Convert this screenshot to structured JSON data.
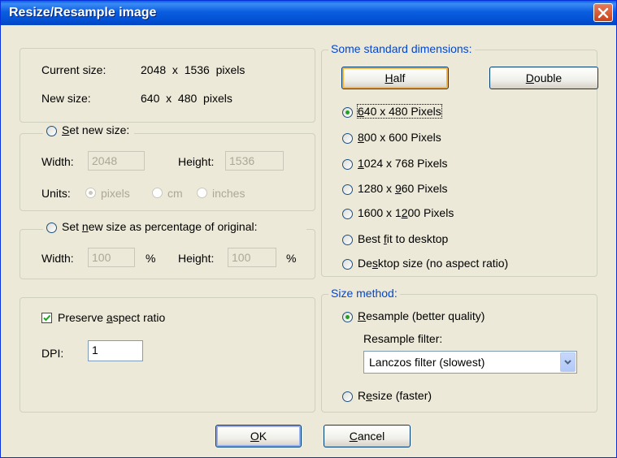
{
  "window": {
    "title": "Resize/Resample image"
  },
  "info": {
    "current_label": "Current size:",
    "current_value": "2048  x  1536  pixels",
    "new_label": "New size:",
    "new_value": "640  x  480  pixels"
  },
  "set_new_size": {
    "label_pre": "",
    "label_u": "S",
    "label_post": "et new size:",
    "width_label": "Width:",
    "width_value": "2048",
    "height_label": "Height:",
    "height_value": "1536",
    "units_label": "Units:",
    "units": [
      "pixels",
      "cm",
      "inches"
    ],
    "units_selected": "pixels"
  },
  "percentage": {
    "label_pre": "Set ",
    "label_u": "n",
    "label_post": "ew size as percentage of original:",
    "width_label": "Width:",
    "width_value": "100",
    "height_label": "Height:",
    "height_value": "100",
    "pct": "%"
  },
  "aspect": {
    "label_pre": "Preserve ",
    "label_u": "a",
    "label_post": "spect ratio",
    "checked": true,
    "dpi_label": "DPI:",
    "dpi_value": "1"
  },
  "standard": {
    "legend": "Some standard dimensions:",
    "half_u": "H",
    "half_post": "alf",
    "double_u": "D",
    "double_post": "ouble",
    "options": [
      {
        "pre": "",
        "u": "6",
        "post": "40 x 480 Pixels",
        "selected": true
      },
      {
        "pre": "",
        "u": "8",
        "post": "00 x 600 Pixels",
        "selected": false
      },
      {
        "pre": "",
        "u": "1",
        "post": "024 x 768 Pixels",
        "selected": false
      },
      {
        "pre": "1280 x ",
        "u": "9",
        "post": "60 Pixels",
        "selected": false
      },
      {
        "pre": "1600 x 1",
        "u": "2",
        "post": "00 Pixels",
        "selected": false
      },
      {
        "pre": "Best ",
        "u": "f",
        "post": "it to desktop",
        "selected": false
      },
      {
        "pre": "De",
        "u": "s",
        "post": "ktop size (no aspect ratio)",
        "selected": false
      }
    ]
  },
  "method": {
    "legend": "Size method:",
    "resample_pre": "",
    "resample_u": "R",
    "resample_post": "esample (better quality)",
    "filter_label": "Resample filter:",
    "filter_value": "Lanczos filter (slowest)",
    "resize_pre": "R",
    "resize_u": "e",
    "resize_post": "size (faster)",
    "selected": "resample"
  },
  "buttons": {
    "ok_u": "O",
    "ok_post": "K",
    "cancel_u": "C",
    "cancel_post": "ancel"
  }
}
